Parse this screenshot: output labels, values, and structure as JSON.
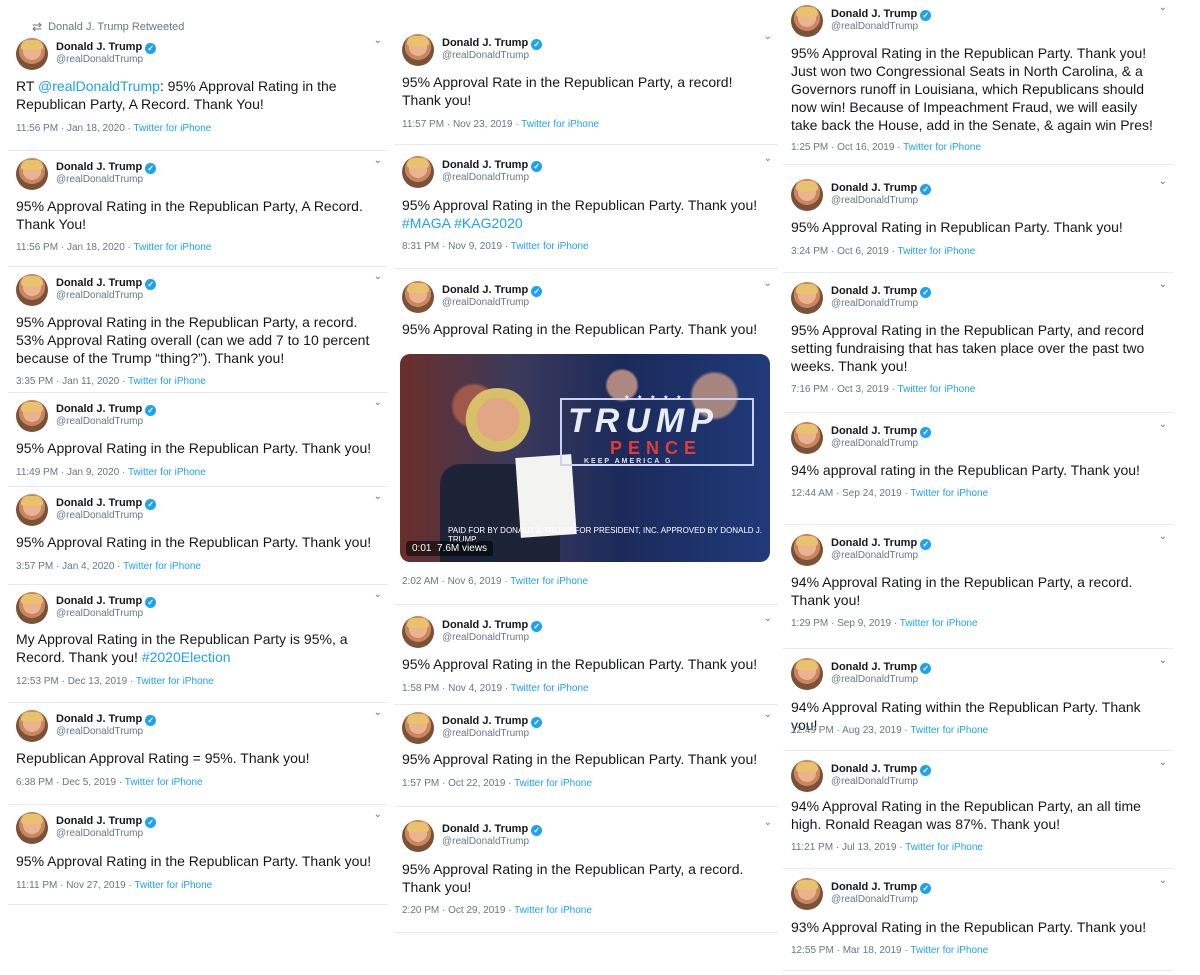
{
  "author": {
    "name": "Donald J. Trump",
    "handle": "@realDonaldTrump",
    "verified_mark": "✓"
  },
  "icons": {
    "avatar": "trump-avatar",
    "verified": "verified-badge-icon",
    "menu": "chevron-down-icon",
    "retweet": "retweet-icon",
    "media": "video-thumbnail"
  },
  "columns": [
    {
      "tweets": [
        {
          "retweet_header": "Donald J. Trump Retweeted",
          "text_parts": [
            "RT ",
            "@realDonaldTrump",
            ": 95% Approval Rating in the Republican Party, A Record. Thank You!"
          ],
          "timestamp": "11:56 PM · Jan 18, 2020",
          "source": "Twitter for iPhone"
        },
        {
          "text": "95% Approval Rating in the Republican Party, A Record. Thank You!",
          "timestamp": "11:56 PM · Jan 18, 2020",
          "source": "Twitter for iPhone"
        },
        {
          "text": "95% Approval Rating in the Republican Party, a record. 53% Approval Rating overall (can we add 7 to 10 percent because of the Trump “thing?”). Thank you!",
          "timestamp": "3:35 PM · Jan 11, 2020",
          "source": "Twitter for iPhone"
        },
        {
          "text": "95% Approval Rating in the Republican Party. Thank you!",
          "timestamp": "11:49 PM · Jan 9, 2020",
          "source": "Twitter for iPhone"
        },
        {
          "text": "95% Approval Rating in the Republican Party. Thank you!",
          "timestamp": "3:57 PM · Jan 4, 2020",
          "source": "Twitter for iPhone"
        },
        {
          "text_parts": [
            "My Approval Rating in the Republican Party is 95%, a Record. Thank you! ",
            "#2020Election"
          ],
          "timestamp": "12:53 PM · Dec 13, 2019",
          "source": "Twitter for iPhone"
        },
        {
          "text": "Republican Approval Rating = 95%. Thank you!",
          "timestamp": "6:38 PM · Dec 5, 2019",
          "source": "Twitter for iPhone"
        },
        {
          "text": "95% Approval Rating in the Republican Party. Thank you!",
          "timestamp": "11:11 PM · Nov 27, 2019",
          "source": "Twitter for iPhone"
        }
      ]
    },
    {
      "tweets": [
        {
          "text": "95% Approval Rate in the Republican Party, a record! Thank you!",
          "timestamp": "11:57 PM · Nov 23, 2019",
          "source": "Twitter for iPhone"
        },
        {
          "text_parts": [
            "95% Approval Rating in the Republican Party. Thank you! ",
            "#MAGA",
            " ",
            "#KAG2020"
          ],
          "timestamp": "8:31 PM · Nov 9, 2019",
          "source": "Twitter for iPhone"
        },
        {
          "text": "95% Approval Rating in the Republican Party. Thank you!",
          "media": {
            "sign_main": "TRUMP",
            "sign_sub": "PENCE",
            "sign_tag": "KEEP AMERICA G",
            "stars": "★ ★ ★ ★ ★",
            "disclaimer": "PAID FOR BY DONALD J. TRUMP FOR PRESIDENT, INC. APPROVED BY DONALD J. TRUMP.",
            "duration": "0:01",
            "views": "7.6M views"
          },
          "timestamp": "2:02 AM · Nov 6, 2019",
          "source": "Twitter for iPhone"
        },
        {
          "text": "95% Approval Rating in the Republican Party. Thank you!",
          "timestamp": "1:58 PM · Nov 4, 2019",
          "source": "Twitter for iPhone"
        },
        {
          "text": "95% Approval Rating in the Republican Party. Thank you!",
          "timestamp": "1:57 PM · Oct 22, 2019",
          "source": "Twitter for iPhone"
        },
        {
          "text": "95% Approval Rating in the Republican Party, a record. Thank you!",
          "timestamp": "2:20 PM · Oct 29, 2019",
          "source": "Twitter for iPhone"
        }
      ]
    },
    {
      "tweets": [
        {
          "text": "95% Approval Rating in the Republican Party. Thank you! Just won two Congressional Seats in North Carolina,  & a Governors runoff in Louisiana, which Republicans should now win! Because of Impeachment Fraud, we will easily take back the House, add in the Senate, & again win Pres!",
          "timestamp": "1:25 PM · Oct 16, 2019",
          "source": "Twitter for iPhone"
        },
        {
          "text": "95% Approval Rating in Republican Party. Thank you!",
          "timestamp": "3:24 PM · Oct 6, 2019",
          "source": "Twitter for iPhone"
        },
        {
          "text": "95% Approval Rating in the Republican Party, and record setting fundraising that has taken place over the past two weeks. Thank you!",
          "timestamp": "7:16 PM · Oct 3, 2019",
          "source": "Twitter for iPhone"
        },
        {
          "text": "94% approval rating in the Republican Party. Thank you!",
          "timestamp": "12:44 AM · Sep 24, 2019",
          "source": "Twitter for iPhone"
        },
        {
          "text": "94% Approval Rating in the Republican Party, a record. Thank you!",
          "timestamp": "1:29 PM · Sep 9, 2019",
          "source": "Twitter for iPhone"
        },
        {
          "text": "94% Approval Rating within the  Republican Party. Thank you!",
          "timestamp": "12:49 PM · Aug 23, 2019",
          "source": "Twitter for iPhone"
        },
        {
          "text": "94% Approval Rating in the Republican Party, an all time high. Ronald Reagan was 87%. Thank you!",
          "timestamp": "11:21 PM · Jul 13, 2019",
          "source": "Twitter for iPhone"
        },
        {
          "text": "93% Approval Rating in the Republican Party. Thank you!",
          "timestamp": "12:55 PM · Mar 18, 2019",
          "source": "Twitter for iPhone"
        }
      ]
    }
  ]
}
